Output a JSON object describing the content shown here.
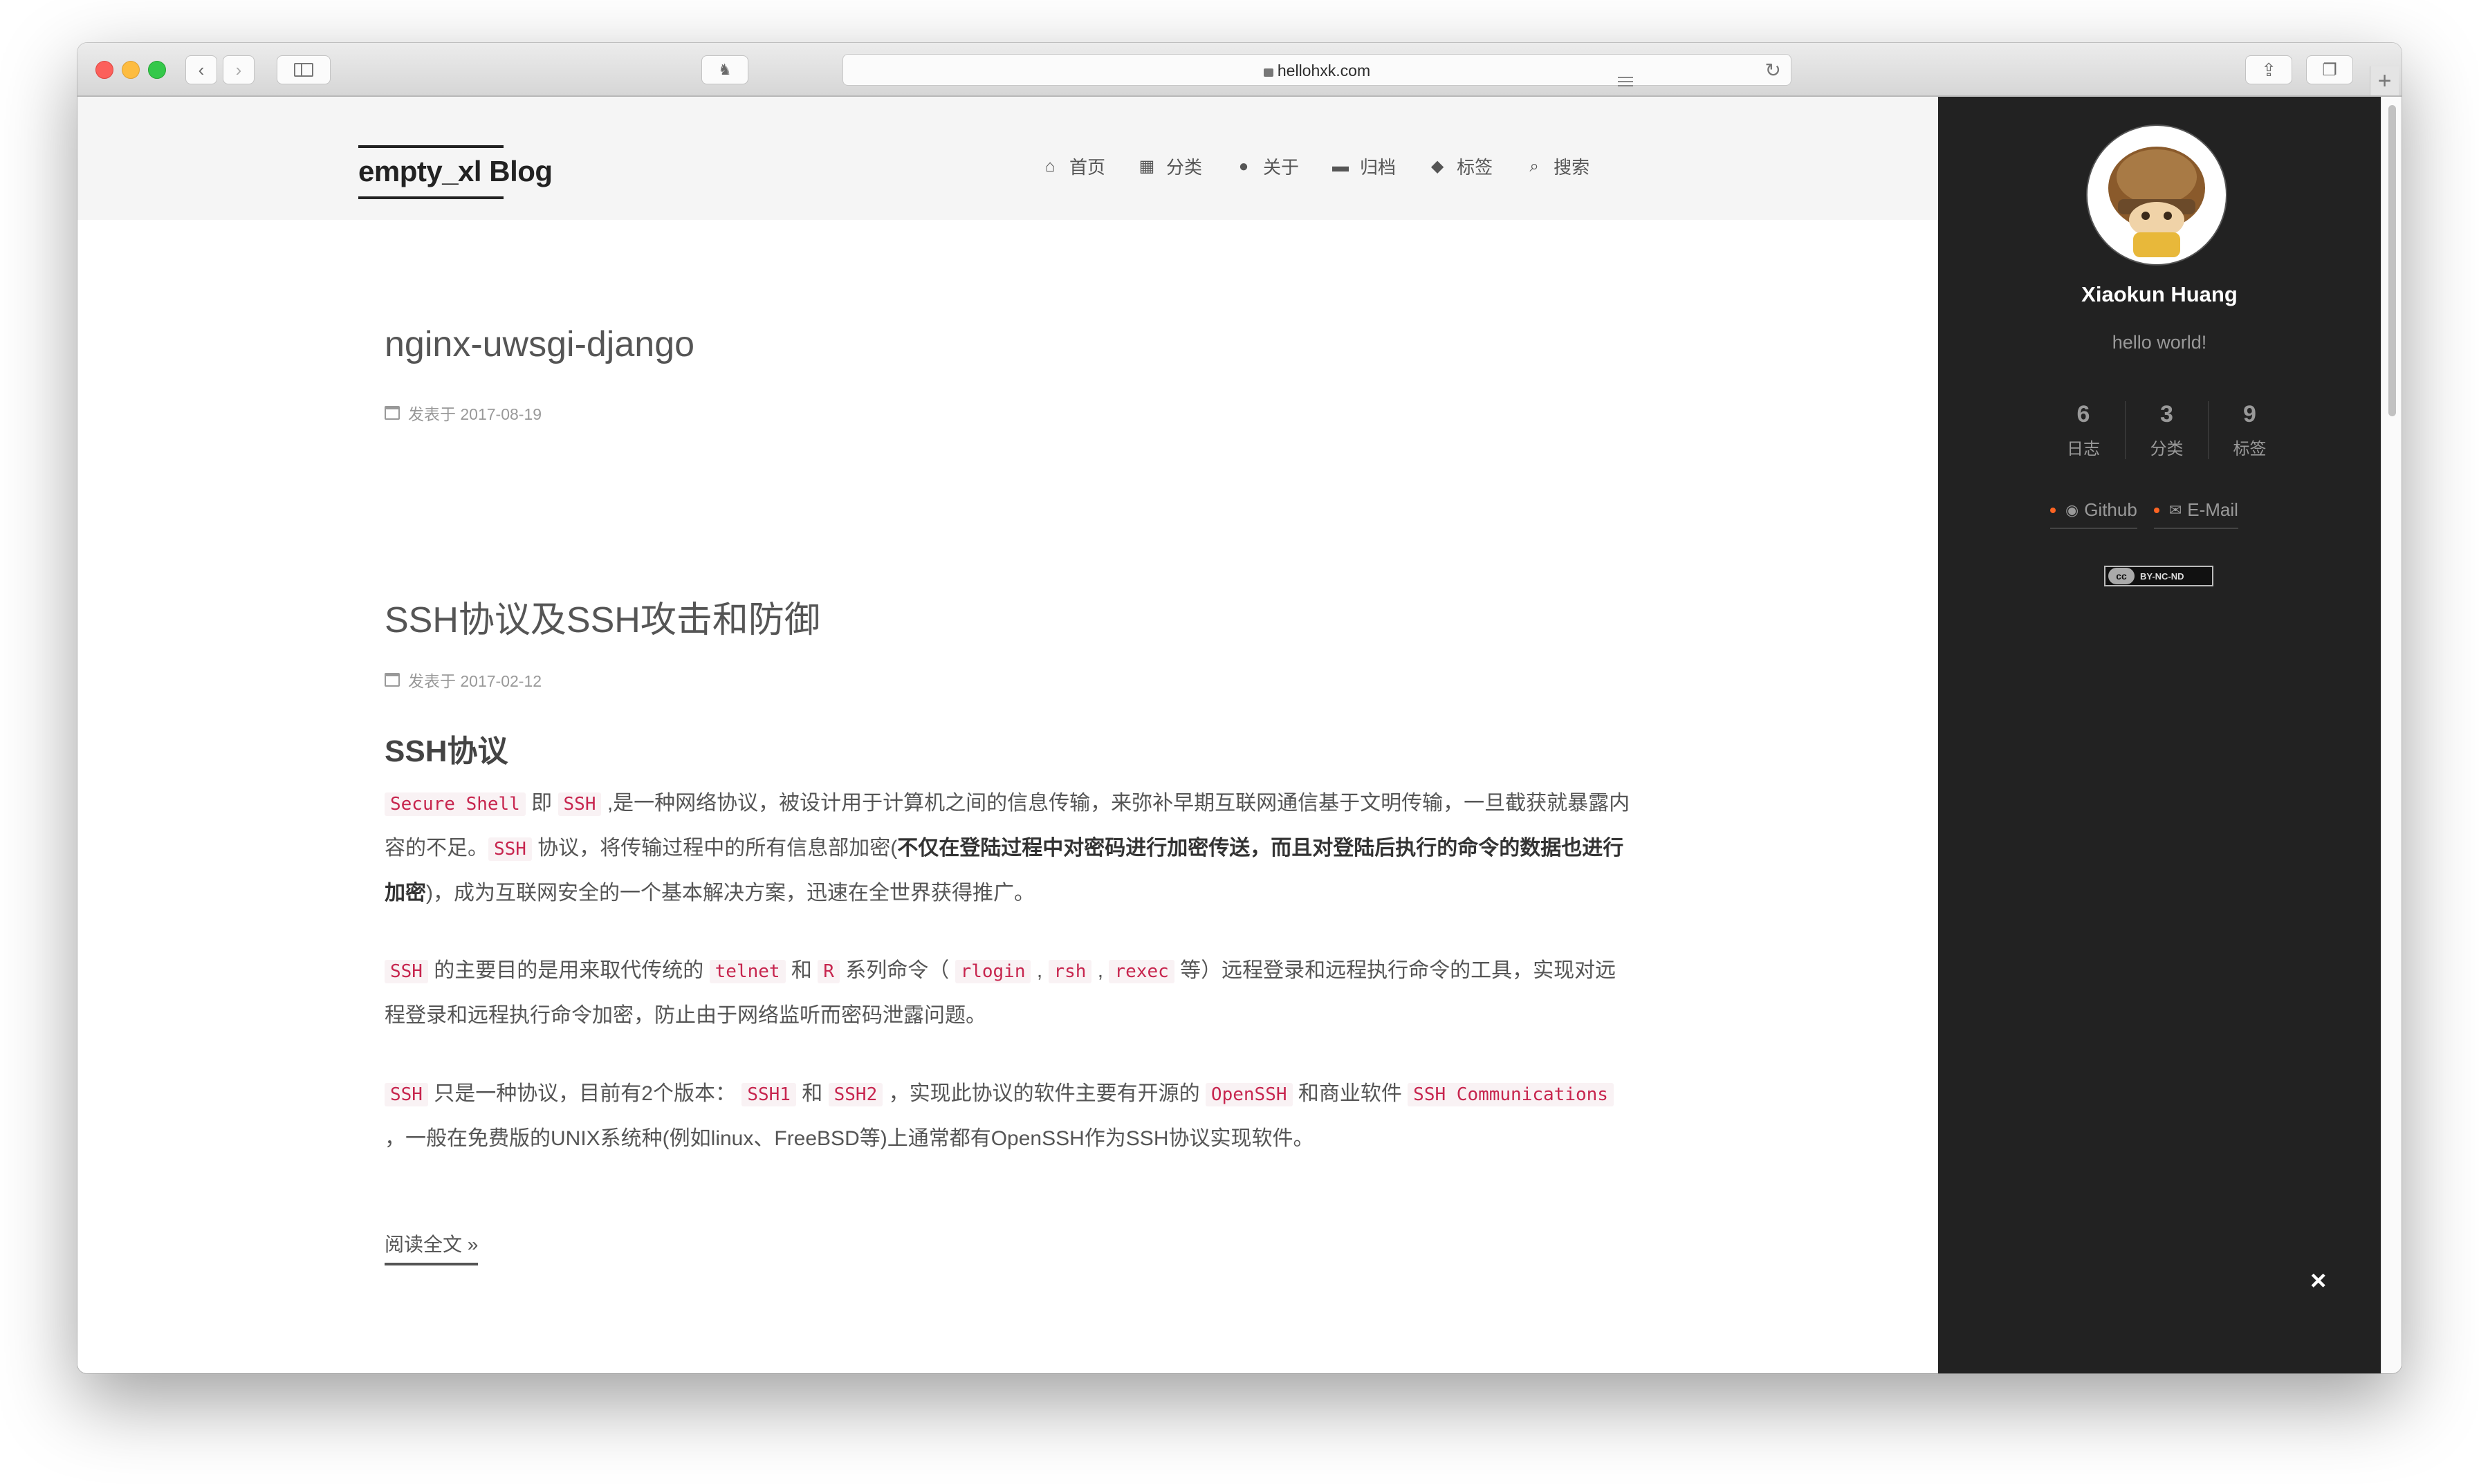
{
  "browser": {
    "url": "hellohxk.com"
  },
  "site": {
    "title": "empty_xl Blog",
    "nav": [
      {
        "icon": "home-icon",
        "glyph": "⌂",
        "label": "首页"
      },
      {
        "icon": "grid-icon",
        "glyph": "▦",
        "label": "分类"
      },
      {
        "icon": "user-icon",
        "glyph": "●",
        "label": "关于"
      },
      {
        "icon": "archive-icon",
        "glyph": "▬",
        "label": "归档"
      },
      {
        "icon": "tags-icon",
        "glyph": "◆",
        "label": "标签"
      },
      {
        "icon": "search-icon",
        "glyph": "⌕",
        "label": "搜索"
      }
    ]
  },
  "posts": [
    {
      "title": "nginx-uwsgi-django",
      "meta": "发表于 2017-08-19"
    },
    {
      "title": "SSH协议及SSH攻击和防御",
      "meta": "发表于 2017-02-12",
      "section": "SSH协议",
      "p1": {
        "c1": "Secure Shell",
        "t1": " 即 ",
        "c2": "SSH",
        "t2": " ,是一种网络协议，被设计用于计算机之间的信息传输，来弥补早期互联网通信基于文明传输，一旦截获就暴露内容的不足。",
        "c3": "SSH",
        "t3": " 协议，将传输过程中的所有信息部加密(",
        "bold": "不仅在登陆过程中对密码进行加密传送，而且对登陆后执行的命令的数据也进行加密",
        "t4": ")，成为互联网安全的一个基本解决方案，迅速在全世界获得推广。"
      },
      "p2": {
        "c1": "SSH",
        "t1": " 的主要目的是用来取代传统的 ",
        "c2": "telnet",
        "t2": " 和 ",
        "c3": "R",
        "t3": " 系列命令（ ",
        "c4": "rlogin",
        "t4": " , ",
        "c5": "rsh",
        "t5": " , ",
        "c6": "rexec",
        "t6": " 等）远程登录和远程执行命令的工具，实现对远程登录和远程执行命令加密，防止由于网络监听而密码泄露问题。"
      },
      "p3": {
        "c1": "SSH",
        "t1": " 只是一种协议，目前有2个版本： ",
        "c2": "SSH1",
        "t2": " 和 ",
        "c3": "SSH2",
        "t3": " ，实现此协议的软件主要有开源的 ",
        "c4": "OpenSSH",
        "t4": " 和商业软件 ",
        "c5": "SSH Communications",
        "t5": " ，一般在免费版的UNIX系统种(例如linux、FreeBSD等)上通常都有OpenSSH作为SSH协议实现软件。"
      },
      "readmore": "阅读全文 »"
    }
  ],
  "sidebar": {
    "author": "Xiaokun Huang",
    "motto": "hello world!",
    "stats": [
      {
        "count": "6",
        "label": "日志"
      },
      {
        "count": "3",
        "label": "分类"
      },
      {
        "count": "9",
        "label": "标签"
      }
    ],
    "links": [
      {
        "icon": "github-icon",
        "label": "Github"
      },
      {
        "icon": "mail-icon",
        "label": "E-Mail"
      }
    ],
    "license": "BY-NC-ND",
    "license_logo": "cc",
    "close": "×"
  },
  "colors": {
    "sidebar_bg": "#222222",
    "header_bg": "#f5f5f5",
    "code_fg": "#c7254e",
    "code_bg": "#f9f2f4",
    "link_dot": "#fc6423"
  }
}
